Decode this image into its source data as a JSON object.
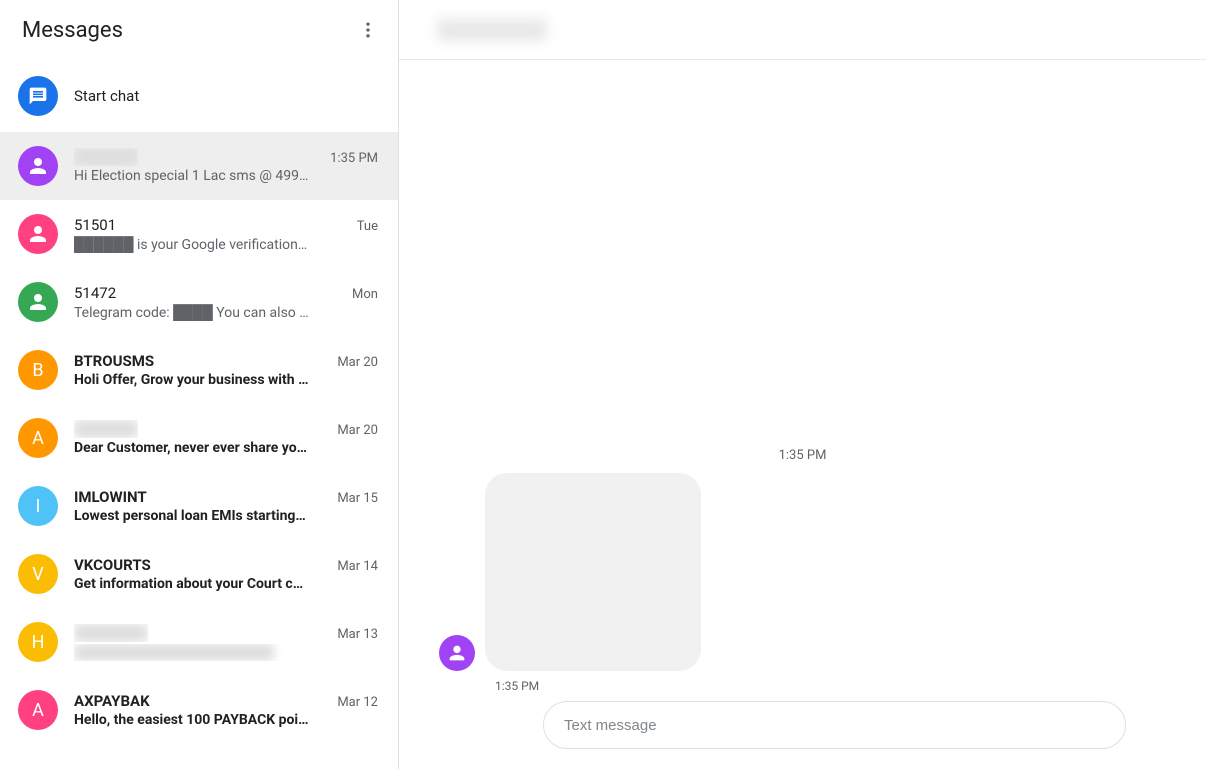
{
  "sidebar": {
    "title": "Messages",
    "start_chat_label": "Start chat"
  },
  "conversations": [
    {
      "name": "██████",
      "preview": "Hi Election special 1 Lac sms @ 499…",
      "time": "1:35 PM",
      "avatar_type": "person",
      "avatar_color": "#a142f4",
      "selected": true,
      "unread": false,
      "name_blurred": true
    },
    {
      "name": "51501",
      "preview": "██████ is your Google verification…",
      "time": "Tue",
      "avatar_type": "person",
      "avatar_color": "#ff4081",
      "selected": false,
      "unread": false
    },
    {
      "name": "51472",
      "preview": "Telegram code: ████ You can also …",
      "time": "Mon",
      "avatar_type": "person",
      "avatar_color": "#34a853",
      "selected": false,
      "unread": false
    },
    {
      "name": "BTROUSMS",
      "preview": "Holi Offer, Grow your business with …",
      "time": "Mar 20",
      "avatar_type": "letter",
      "avatar_letter": "B",
      "avatar_color": "#ff9800",
      "selected": false,
      "unread": true
    },
    {
      "name": "██████",
      "preview": "Dear Customer, never ever share yo…",
      "time": "Mar 20",
      "avatar_type": "letter",
      "avatar_letter": "A",
      "avatar_color": "#ff9800",
      "selected": false,
      "unread": true,
      "name_blurred": true
    },
    {
      "name": "IMLOWINT",
      "preview": "Lowest personal loan EMIs starting …",
      "time": "Mar 15",
      "avatar_type": "letter",
      "avatar_letter": "I",
      "avatar_color": "#4fc3f7",
      "selected": false,
      "unread": true
    },
    {
      "name": "VKCOURTS",
      "preview": "Get information about your Court ca…",
      "time": "Mar 14",
      "avatar_type": "letter",
      "avatar_letter": "V",
      "avatar_color": "#fbbc04",
      "selected": false,
      "unread": true
    },
    {
      "name": "H██████",
      "preview": "Y██████████████████",
      "time": "Mar 13",
      "avatar_type": "letter",
      "avatar_letter": "H",
      "avatar_color": "#fbbc04",
      "selected": false,
      "unread": true,
      "name_blurred": true,
      "preview_blurred": true
    },
    {
      "name": "AXPAYBAK",
      "preview": "Hello, the easiest 100 PAYBACK poi…",
      "time": "Mar 12",
      "avatar_type": "letter",
      "avatar_letter": "A",
      "avatar_color": "#ff4081",
      "selected": false,
      "unread": true
    }
  ],
  "chat": {
    "header_name": "██████",
    "timestamp_center": "1:35 PM",
    "message_time": "1:35 PM",
    "bubble_avatar_color": "#a142f4"
  },
  "compose": {
    "placeholder": "Text message"
  }
}
